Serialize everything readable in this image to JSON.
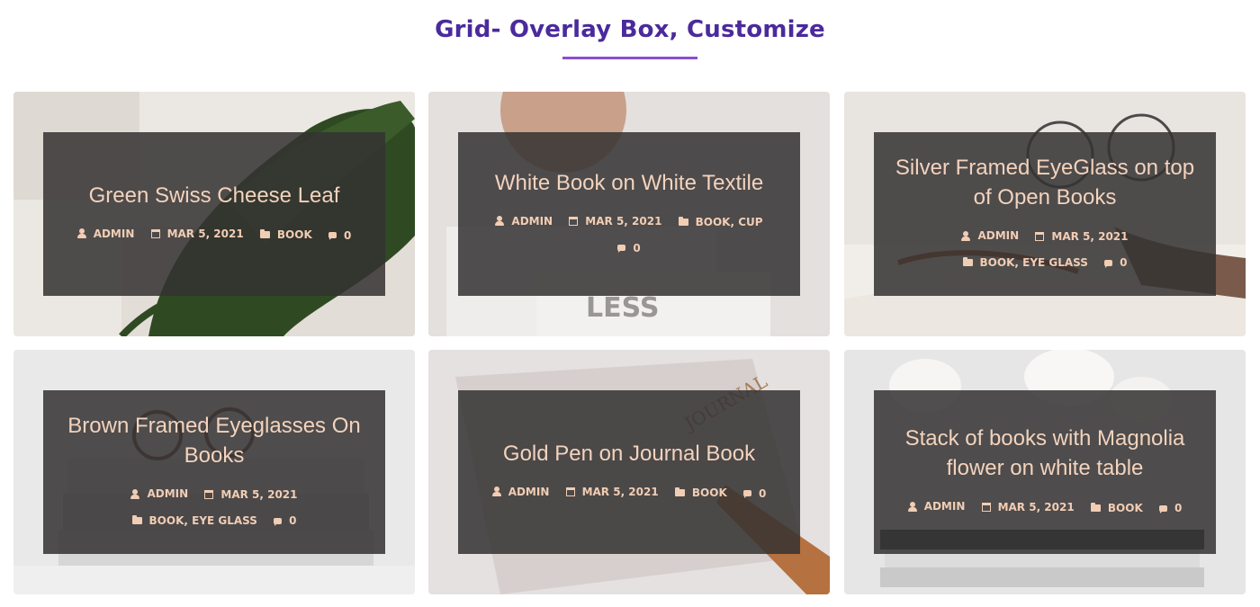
{
  "header": {
    "title": "Grid- Overlay Box, Customize"
  },
  "posts": [
    {
      "title": "Green Swiss Cheese Leaf",
      "author": "ADMIN",
      "date": "MAR 5, 2021",
      "categories": [
        "BOOK"
      ],
      "comments": "0"
    },
    {
      "title": "White Book on White Textile",
      "author": "ADMIN",
      "date": "MAR 5, 2021",
      "categories": [
        "BOOK",
        "CUP"
      ],
      "comments": "0"
    },
    {
      "title": "Silver Framed EyeGlass on top of Open Books",
      "author": "ADMIN",
      "date": "MAR 5, 2021",
      "categories": [
        "BOOK",
        "EYE GLASS"
      ],
      "comments": "0"
    },
    {
      "title": "Brown Framed Eyeglasses On Books",
      "author": "ADMIN",
      "date": "MAR 5, 2021",
      "categories": [
        "BOOK",
        "EYE GLASS"
      ],
      "comments": "0"
    },
    {
      "title": "Gold Pen on Journal Book",
      "author": "ADMIN",
      "date": "MAR 5, 2021",
      "categories": [
        "BOOK"
      ],
      "comments": "0"
    },
    {
      "title": "Stack of books with Magnolia flower on white table",
      "author": "ADMIN",
      "date": "MAR 5, 2021",
      "categories": [
        "BOOK"
      ],
      "comments": "0"
    }
  ],
  "icons": {
    "author": "user-icon",
    "date": "calendar-icon",
    "category": "folder-icon",
    "comments": "comment-icon"
  },
  "colors": {
    "heading": "#4a2a9c",
    "underline": "#8a4fd0",
    "overlay": "#343232",
    "overlay_text": "#f3d3bd"
  }
}
